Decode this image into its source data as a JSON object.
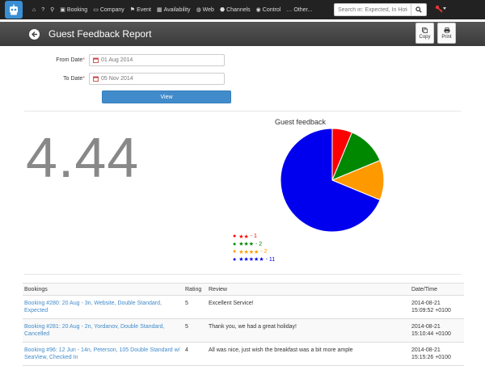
{
  "nav": {
    "items": [
      {
        "icon": "home-icon",
        "glyph": "⌂",
        "label": ""
      },
      {
        "icon": "help-icon",
        "glyph": "?",
        "label": ""
      },
      {
        "icon": "zoom-icon",
        "glyph": "⚲",
        "label": ""
      },
      {
        "icon": "briefcase-icon",
        "glyph": "▣",
        "label": "Booking"
      },
      {
        "icon": "folder-icon",
        "glyph": "▭",
        "label": "Company"
      },
      {
        "icon": "flag-icon",
        "glyph": "⚑",
        "label": "Event"
      },
      {
        "icon": "calendar-icon",
        "glyph": "▦",
        "label": "Availability"
      },
      {
        "icon": "globe-icon",
        "glyph": "◍",
        "label": "Web"
      },
      {
        "icon": "share-icon",
        "glyph": "⬣",
        "label": "Channels"
      },
      {
        "icon": "eye-icon",
        "glyph": "◉",
        "label": "Control"
      },
      {
        "icon": "ellipsis-icon",
        "glyph": "…",
        "label": "Other..."
      }
    ],
    "search_placeholder": "Search in: Expected, In Hote"
  },
  "header": {
    "title": "Guest Feedback Report",
    "copy_label": "Copy",
    "print_label": "Print"
  },
  "form": {
    "from_label": "From Date",
    "to_label": "To Date",
    "required_mark": "*",
    "from_value": "01 Aug 2014",
    "to_value": "05 Nov 2014",
    "view_label": "View"
  },
  "summary": {
    "average_rating": "4.44"
  },
  "chart_data": {
    "type": "pie",
    "title": "Guest feedback",
    "slices": [
      {
        "label": "★★",
        "count": 1,
        "color": "#ff0000"
      },
      {
        "label": "★★★",
        "count": 2,
        "color": "#008800"
      },
      {
        "label": "★★★★",
        "count": 2,
        "color": "#ff9900"
      },
      {
        "label": "★★★★★",
        "count": 11,
        "color": "#0000ee"
      }
    ],
    "legend_placement": "bottom-left"
  },
  "table": {
    "headers": [
      "Bookings",
      "Rating",
      "Review",
      "Date/Time"
    ],
    "rows": [
      {
        "booking": "Booking #280: 20 Aug - 3n, Website, Double Standard, Expected",
        "rating": "5",
        "review": "Excellent Service!",
        "date": "2014-08-21",
        "time": "15:09:52 +0100"
      },
      {
        "booking": "Booking #281: 20 Aug - 2n, Yordanov, Double Standard, Cancelled",
        "rating": "5",
        "review": "Thank you, we had a great holiday!",
        "date": "2014-08-21",
        "time": "15:10:44 +0100"
      },
      {
        "booking": "Booking #96: 12 Jun - 14n, Peterson, 105 Double Standard w/ SeaView, Checked In",
        "rating": "4",
        "review": "All was nice, just wish the breakfast was a bit more ample",
        "date": "2014-08-21",
        "time": "15:15:26 +0100"
      }
    ]
  }
}
